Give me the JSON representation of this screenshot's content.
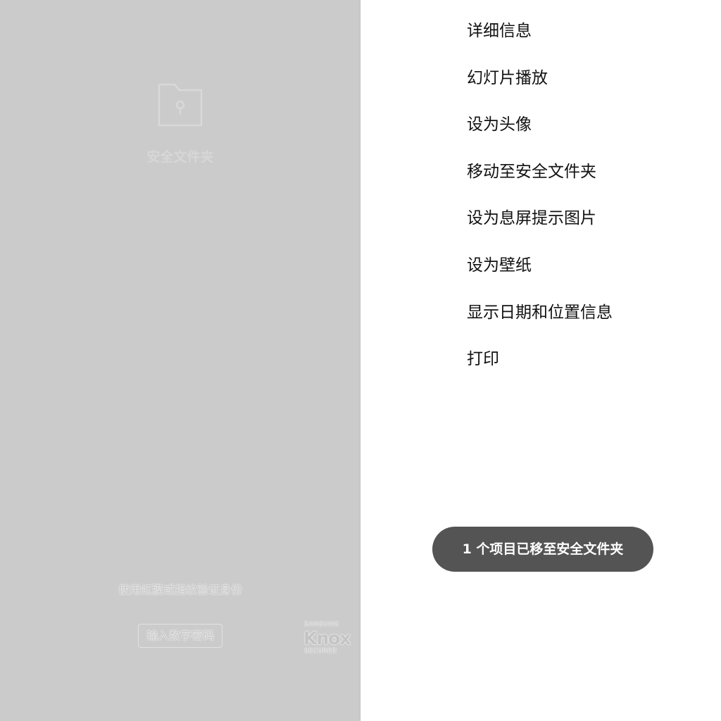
{
  "secure_folder": {
    "title": "安全文件夹",
    "verify_prompt": "使用虹膜或指纹验证身份",
    "pin_button_label": "输入数字密码",
    "icon": "locked-folder-icon",
    "knox": {
      "brand": "SAMSUNG",
      "name": "Knox",
      "subtitle": "SECURED"
    }
  },
  "context_menu": {
    "items": [
      {
        "label": "详细信息"
      },
      {
        "label": "幻灯片播放"
      },
      {
        "label": "设为头像"
      },
      {
        "label": "移动至安全文件夹"
      },
      {
        "label": "设为息屏提示图片"
      },
      {
        "label": "设为壁纸"
      },
      {
        "label": "显示日期和位置信息"
      },
      {
        "label": "打印"
      }
    ]
  },
  "toast": {
    "message": "1 个项目已移至安全文件夹"
  },
  "colors": {
    "panel_background": "#cbcbcb",
    "toast_background": "#545454",
    "menu_text": "#111111"
  }
}
